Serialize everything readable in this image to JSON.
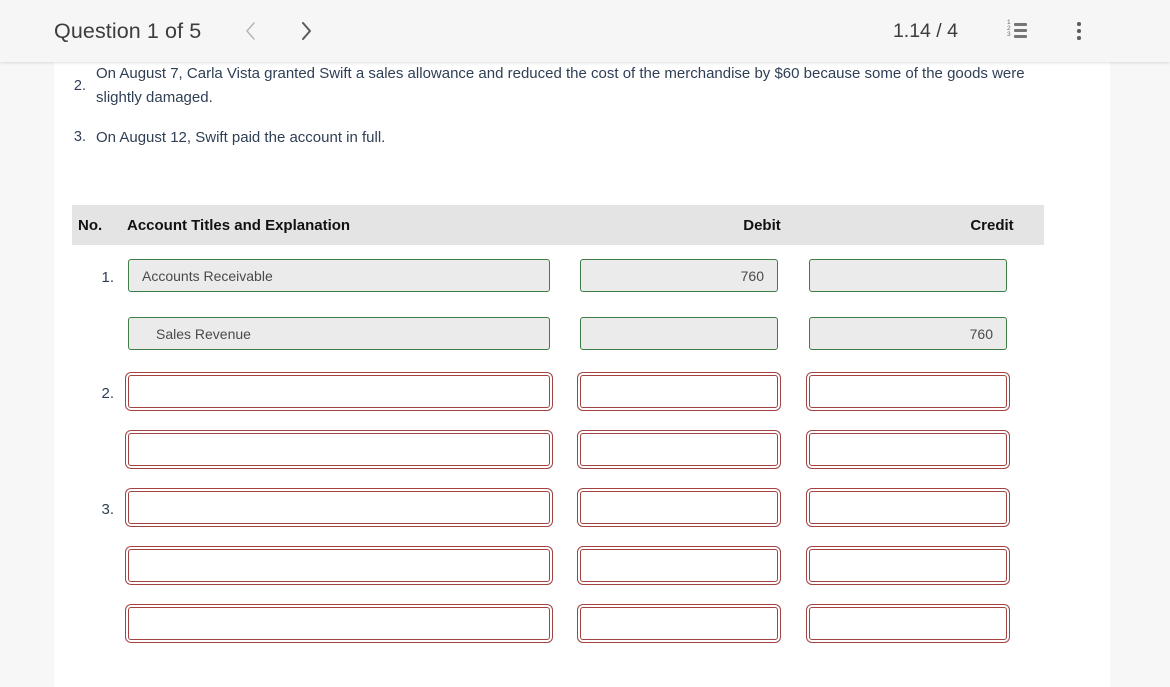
{
  "topbar": {
    "question_title": "Question 1 of 5",
    "prev_label": "‹",
    "next_label": "›",
    "score": "1.14 / 4",
    "list_icon_numbers": [
      "1",
      "2",
      "3"
    ]
  },
  "question": {
    "items": [
      {
        "num": "2.",
        "text": "On August 7, Carla Vista granted Swift a sales allowance and reduced the cost of the merchandise by $60 because some of the goods were slightly damaged."
      },
      {
        "num": "3.",
        "text": "On August 12, Swift paid the account in full."
      }
    ]
  },
  "journal": {
    "headers": {
      "no": "No.",
      "account": "Account Titles and Explanation",
      "debit": "Debit",
      "credit": "Credit"
    },
    "rows": [
      {
        "num": "1.",
        "account": "Accounts Receivable",
        "indent": false,
        "debit": "760",
        "credit": "",
        "state": "filled"
      },
      {
        "num": "",
        "account": "Sales Revenue",
        "indent": true,
        "debit": "",
        "credit": "760",
        "state": "filled"
      },
      {
        "num": "2.",
        "account": "",
        "indent": false,
        "debit": "",
        "credit": "",
        "state": "empty"
      },
      {
        "num": "",
        "account": "",
        "indent": false,
        "debit": "",
        "credit": "",
        "state": "empty"
      },
      {
        "num": "3.",
        "account": "",
        "indent": false,
        "debit": "",
        "credit": "",
        "state": "empty"
      },
      {
        "num": "",
        "account": "",
        "indent": false,
        "debit": "",
        "credit": "",
        "state": "empty"
      },
      {
        "num": "",
        "account": "",
        "indent": false,
        "debit": "",
        "credit": "",
        "state": "empty"
      }
    ]
  },
  "colors": {
    "filled_border": "#3f7d46",
    "filled_bg": "#ebebeb",
    "empty_border": "#a24242",
    "header_bg": "#e4e4e4",
    "text": "#2f3f55"
  }
}
